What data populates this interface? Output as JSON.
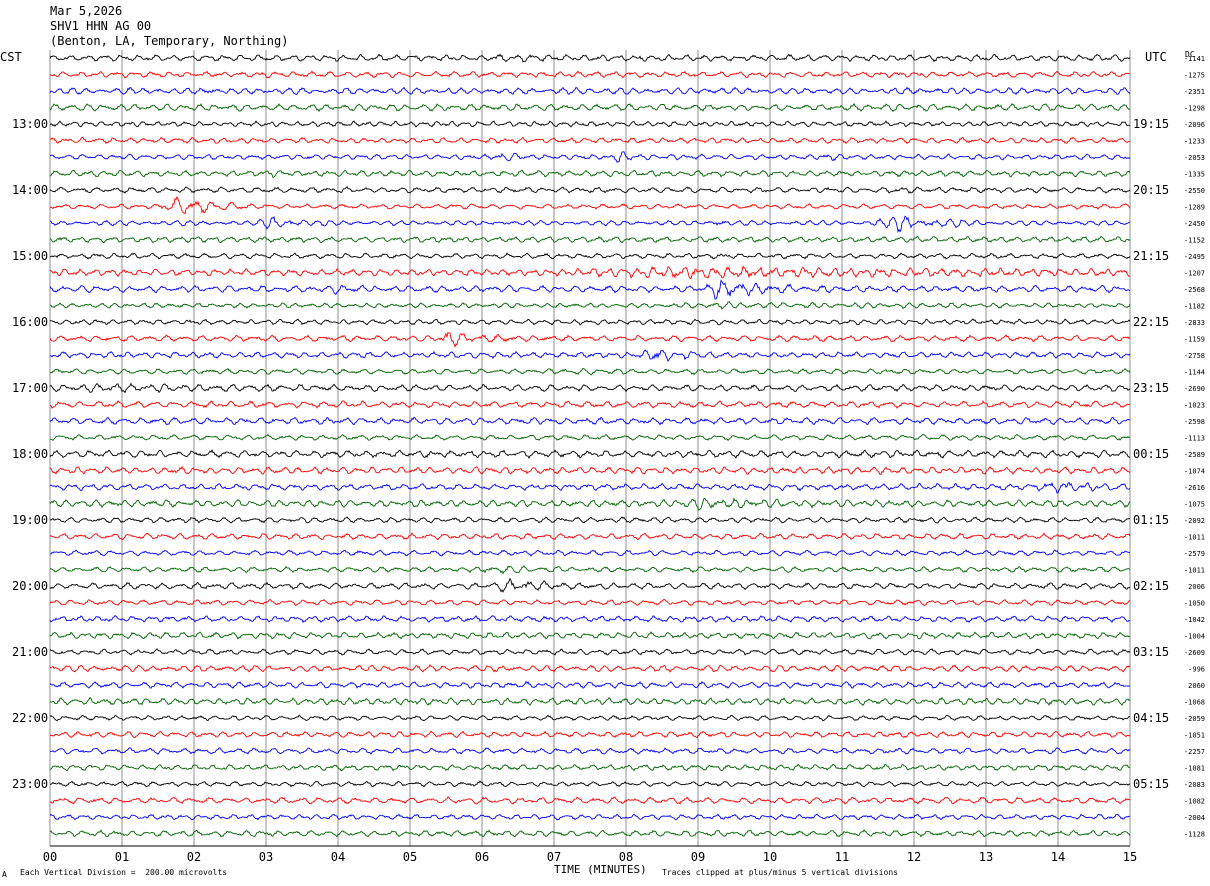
{
  "header": {
    "date": "Mar 5,2026",
    "station": "SHV1 HHN AG 00",
    "location": "(Benton, LA, Temporary, Northing)"
  },
  "axes": {
    "left_tz": "CST",
    "right_tz": "UTC",
    "dc_label": "DC",
    "x_title": "TIME (MINUTES)"
  },
  "footer": {
    "left_mark": "A",
    "division_note": "Each Vertical Division =  200.00 microvolts",
    "clip_note": "Traces clipped at plus/minus 5 vertical divisions"
  },
  "colors": {
    "cycle": [
      "#000000",
      "#ff0000",
      "#0000ff",
      "#006400"
    ],
    "grid": "#606060"
  },
  "chart_data": {
    "type": "seismogram (helicorder)",
    "x_ticks": [
      "00",
      "01",
      "02",
      "03",
      "04",
      "05",
      "06",
      "07",
      "08",
      "09",
      "10",
      "11",
      "12",
      "13",
      "14",
      "15"
    ],
    "xlim": [
      0,
      15
    ],
    "trace_count": 48,
    "minutes_per_trace": 15,
    "left_hour_labels": [
      "13:00",
      "14:00",
      "15:00",
      "16:00",
      "17:00",
      "18:00",
      "19:00",
      "20:00",
      "21:00",
      "22:00",
      "23:00"
    ],
    "right_hour_labels": [
      "19:15",
      "20:15",
      "21:15",
      "22:15",
      "23:15",
      "00:15",
      "01:15",
      "02:15",
      "03:15",
      "04:15",
      "05:15"
    ],
    "hour_label_first_trace": 4,
    "dc_offsets": [
      "-1141",
      "-1275",
      "-2351",
      "-1298",
      "-2096",
      "-1233",
      "-2053",
      "-1335",
      "-2550",
      "-1289",
      "-2450",
      "-1152",
      "-2495",
      "-1207",
      "-2568",
      "-1182",
      "-2833",
      "-1159",
      "-2758",
      "-1144",
      "-2690",
      "-1023",
      "-2598",
      "-1113",
      "-2589",
      "-1074",
      "-2616",
      "-1075",
      "-2092",
      "-1011",
      "-2579",
      "-1011",
      "2006",
      "-1050",
      "-1042",
      "-1004",
      "-2609",
      "-996",
      "2060",
      "-1068",
      "-2059",
      "-1051",
      "-2257",
      "-1081",
      "-2083",
      "-1082",
      "-2004",
      "-1128"
    ],
    "events": [
      {
        "trace": 0,
        "minute": 6.3,
        "amp": 1.5,
        "dur": 0.6
      },
      {
        "trace": 6,
        "minute": 6.3,
        "amp": 2.5,
        "dur": 0.35
      },
      {
        "trace": 6,
        "minute": 7.9,
        "amp": 2.5,
        "dur": 0.35
      },
      {
        "trace": 6,
        "minute": 10.8,
        "amp": 2.0,
        "dur": 0.3
      },
      {
        "trace": 7,
        "minute": 3.0,
        "amp": 1.5,
        "dur": 0.3
      },
      {
        "trace": 8,
        "minute": 11.7,
        "amp": 2.0,
        "dur": 0.3
      },
      {
        "trace": 9,
        "minute": 1.8,
        "amp": 4.5,
        "dur": 1.0
      },
      {
        "trace": 10,
        "minute": 3.1,
        "amp": 3.0,
        "dur": 0.8
      },
      {
        "trace": 10,
        "minute": 11.8,
        "amp": 4.0,
        "dur": 1.2
      },
      {
        "trace": 10,
        "minute": 9.2,
        "amp": 1.5,
        "dur": 0.4
      },
      {
        "trace": 13,
        "minute": 9.0,
        "amp": 2.0,
        "dur": 7.0
      },
      {
        "trace": 14,
        "minute": 9.3,
        "amp": 3.5,
        "dur": 1.0
      },
      {
        "trace": 14,
        "minute": 4.0,
        "amp": 2.0,
        "dur": 0.4
      },
      {
        "trace": 15,
        "minute": 9.4,
        "amp": 1.5,
        "dur": 3.5
      },
      {
        "trace": 17,
        "minute": 5.6,
        "amp": 3.0,
        "dur": 0.9
      },
      {
        "trace": 18,
        "minute": 8.4,
        "amp": 2.5,
        "dur": 0.9
      },
      {
        "trace": 19,
        "minute": 7.3,
        "amp": 1.5,
        "dur": 0.8
      },
      {
        "trace": 20,
        "minute": 1.0,
        "amp": 1.5,
        "dur": 3.0
      },
      {
        "trace": 26,
        "minute": 14.0,
        "amp": 2.0,
        "dur": 1.0
      },
      {
        "trace": 27,
        "minute": 9.0,
        "amp": 2.0,
        "dur": 1.6
      },
      {
        "trace": 31,
        "minute": 6.2,
        "amp": 2.0,
        "dur": 0.9
      },
      {
        "trace": 32,
        "minute": 6.4,
        "amp": 2.5,
        "dur": 1.0
      },
      {
        "trace": 43,
        "minute": 8.2,
        "amp": 1.2,
        "dur": 0.4
      }
    ]
  }
}
